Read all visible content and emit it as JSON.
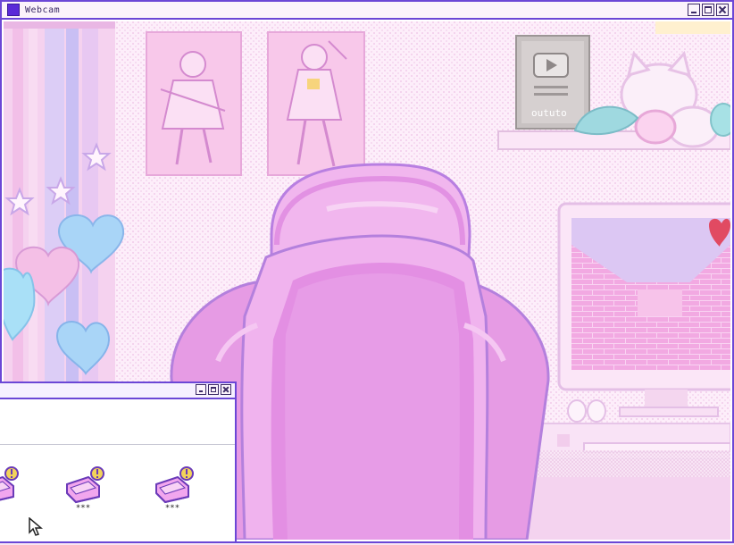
{
  "webcam_window": {
    "title": "Webcam",
    "icon": "webcam-app-icon",
    "buttons": [
      "minimize-icon",
      "maximize-icon",
      "close-icon"
    ]
  },
  "scene": {
    "plaque_text": "oututo",
    "icons": [
      "play-button-icon",
      "heart-icon",
      "star-icon",
      "balloon-heart-icon"
    ]
  },
  "file_window": {
    "buttons": [
      "minimize-icon",
      "maximize-icon",
      "close-icon"
    ],
    "files": [
      {
        "label": "",
        "icon": "bed-alert-icon"
      },
      {
        "label": "***",
        "icon": "bed-alert-icon"
      },
      {
        "label": "***",
        "icon": "bed-alert-icon"
      }
    ]
  },
  "cursor": {
    "icon": "mouse-pointer-icon"
  },
  "colors": {
    "window_border": "#6b47d6",
    "chair": "#e39ee9",
    "accent_purple": "#5a2ad8"
  }
}
